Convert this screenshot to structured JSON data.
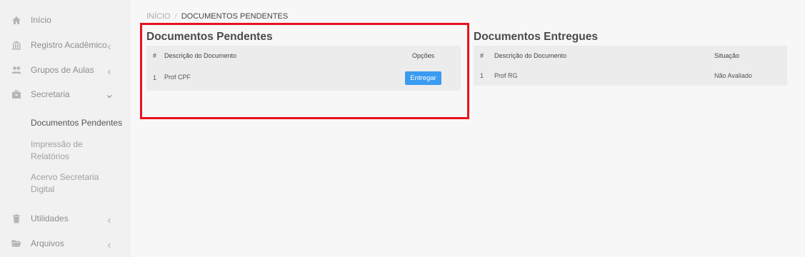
{
  "sidebar": {
    "items": [
      {
        "label": "Início",
        "icon": "home-icon"
      },
      {
        "label": "Registro Acadêmico",
        "icon": "institution-icon"
      },
      {
        "label": "Grupos de Aulas",
        "icon": "users-icon"
      },
      {
        "label": "Secretaria",
        "icon": "briefcase-icon"
      },
      {
        "label": "Utilidades",
        "icon": "trash-icon"
      },
      {
        "label": "Arquivos",
        "icon": "folder-icon"
      }
    ],
    "subitems": [
      {
        "label": "Documentos Pendentes"
      },
      {
        "label": "Impressão de Relatórios"
      },
      {
        "label": "Acervo Secretaria Digital"
      }
    ]
  },
  "breadcrumb": {
    "home": "INÍCIO",
    "separator": "/",
    "current": "DOCUMENTOS PENDENTES"
  },
  "pending": {
    "title": "Documentos Pendentes",
    "columns": [
      "#",
      "Descrição do Documento",
      "Opções"
    ],
    "rows": [
      {
        "num": "1",
        "desc": "Prof CPF",
        "action": "Entregar"
      }
    ]
  },
  "delivered": {
    "title": "Documentos Entregues",
    "columns": [
      "#",
      "Descrição do Documento",
      "Situação"
    ],
    "rows": [
      {
        "num": "1",
        "desc": "Prof RG",
        "status": "Não Avaliado"
      }
    ]
  },
  "colors": {
    "accent": "#3a9bf0",
    "highlight": "#e8121c"
  }
}
